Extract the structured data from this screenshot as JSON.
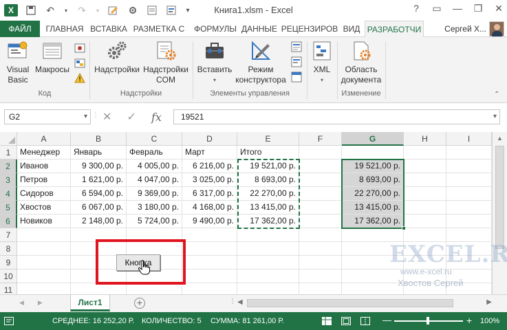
{
  "window": {
    "title": "Книга1.xlsm - Excel",
    "app_icon": "X",
    "controls": [
      "?",
      "▭",
      "—",
      "❐",
      "✕"
    ]
  },
  "tabs": [
    {
      "label": "ФАЙЛ",
      "active": false,
      "file": true
    },
    {
      "label": "ГЛАВНАЯ",
      "active": false
    },
    {
      "label": "ВСТАВКА",
      "active": false
    },
    {
      "label": "РАЗМЕТКА С",
      "active": false
    },
    {
      "label": "ФОРМУЛЫ",
      "active": false
    },
    {
      "label": "ДАННЫЕ",
      "active": false
    },
    {
      "label": "РЕЦЕНЗИРОВ",
      "active": false
    },
    {
      "label": "ВИД",
      "active": false
    },
    {
      "label": "РАЗРАБОТЧИ",
      "active": true
    }
  ],
  "user": {
    "name": "Сергей Х..."
  },
  "ribbon": {
    "visual_basic": "Visual\nBasic",
    "macros": "Макросы",
    "group_code": "Код",
    "addins": "Надстройки",
    "com_addins": "Надстройки\nCOM",
    "group_addins": "Надстройки",
    "insert": "Вставить",
    "design_mode": "Режим\nконструктора",
    "group_controls": "Элементы управления",
    "xml": "XML",
    "doc_panel": "Область\nдокумента",
    "group_modify": "Изменение"
  },
  "formula_bar": {
    "name_box": "G2",
    "cancel": "✕",
    "enter": "✓",
    "fx": "fx",
    "value": "19521"
  },
  "columns": [
    "A",
    "B",
    "C",
    "D",
    "E",
    "F",
    "G",
    "H",
    "I"
  ],
  "rows": [
    "1",
    "2",
    "3",
    "4",
    "5",
    "6",
    "7",
    "8",
    "9",
    "10",
    "11"
  ],
  "table": {
    "headers": [
      "Менеджер",
      "Январь",
      "Февраль",
      "Март",
      "Итого"
    ],
    "rows": [
      [
        "Иванов",
        "9 300,00 р.",
        "4 005,00 р.",
        "6 216,00 р.",
        "19 521,00 р."
      ],
      [
        "Петров",
        "1 621,00 р.",
        "4 047,00 р.",
        "3 025,00 р.",
        "8 693,00 р."
      ],
      [
        "Сидоров",
        "6 594,00 р.",
        "9 369,00 р.",
        "6 317,00 р.",
        "22 270,00 р."
      ],
      [
        "Хвостов",
        "6 067,00 р.",
        "3 180,00 р.",
        "4 168,00 р.",
        "13 415,00 р."
      ],
      [
        "Новиков",
        "2 148,00 р.",
        "5 724,00 р.",
        "9 490,00 р.",
        "17 362,00 р."
      ]
    ],
    "g_values": [
      "19 521,00 р.",
      "8 693,00 р.",
      "22 270,00 р.",
      "13 415,00 р.",
      "17 362,00 р."
    ]
  },
  "form_button": {
    "label": "Кнопка"
  },
  "watermark": {
    "logo": "EXCEL.RU",
    "url": "www.e-xcel.ru",
    "author": "Хвостов Сергей"
  },
  "sheets": [
    {
      "name": "Лист1",
      "active": true
    }
  ],
  "status": {
    "average": "СРЕДНЕЕ:  16 252,20 Р.",
    "count": "КОЛИЧЕСТВО: 5",
    "sum": "СУММА:  81 261,00 Р.",
    "zoom": "100%",
    "zoom_minus": "—",
    "zoom_plus": "+"
  },
  "colors": {
    "accent": "#217346",
    "highlight_box": "#e0141e",
    "selection_fill": "#d6d6d6"
  }
}
